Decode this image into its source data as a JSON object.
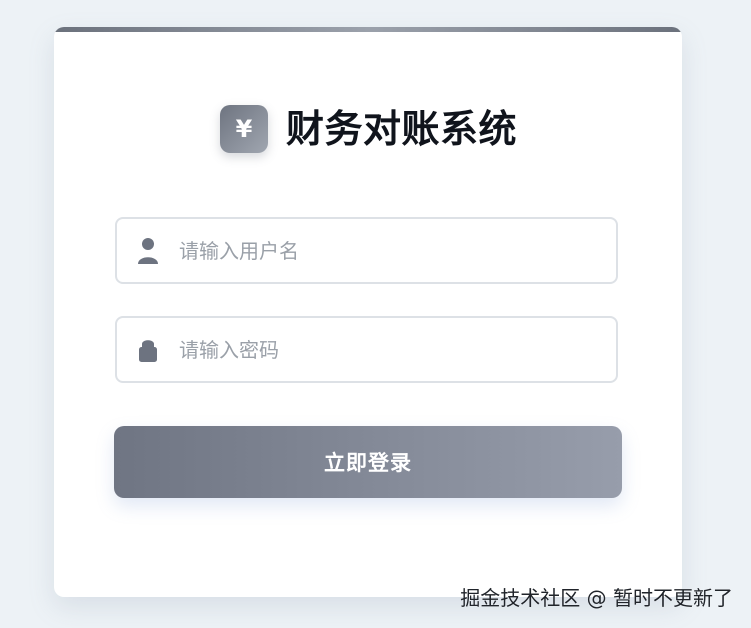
{
  "brand": {
    "icon_symbol": "¥",
    "icon_name": "yen-icon",
    "title": "财务对账系统"
  },
  "form": {
    "username": {
      "placeholder": "请输入用户名",
      "value": "",
      "icon_name": "user-icon"
    },
    "password": {
      "placeholder": "请输入密码",
      "value": "",
      "icon_name": "lock-icon"
    },
    "submit_label": "立即登录"
  },
  "watermark": {
    "text": "掘金技术社区 @ 暂时不更新了"
  },
  "colors": {
    "background": "#edf2f6",
    "card": "#ffffff",
    "accent_gradient_start": "#6f7583",
    "accent_gradient_end": "#979dab",
    "title": "#10141c",
    "placeholder": "#9aa0a8"
  }
}
